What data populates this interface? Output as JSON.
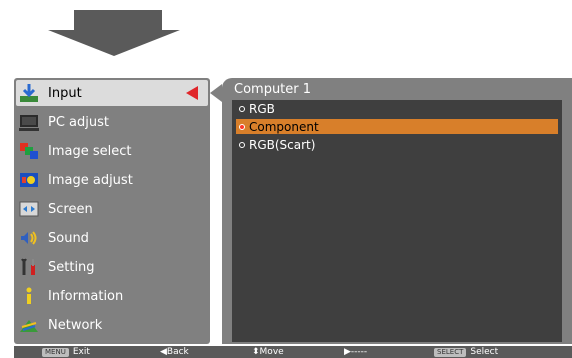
{
  "menu": {
    "items": [
      {
        "label": "Input",
        "icon": "input-icon"
      },
      {
        "label": "PC adjust",
        "icon": "pc-adjust-icon"
      },
      {
        "label": "Image select",
        "icon": "image-select-icon"
      },
      {
        "label": "Image adjust",
        "icon": "image-adjust-icon"
      },
      {
        "label": "Screen",
        "icon": "screen-icon"
      },
      {
        "label": "Sound",
        "icon": "sound-icon"
      },
      {
        "label": "Setting",
        "icon": "setting-icon"
      },
      {
        "label": "Information",
        "icon": "information-icon"
      },
      {
        "label": "Network",
        "icon": "network-icon"
      }
    ],
    "selected_index": 0
  },
  "submenu": {
    "title": "Computer 1",
    "options": [
      "RGB",
      "Component",
      "RGB(Scart)"
    ],
    "selected_index": 1
  },
  "statusbar": {
    "exit_key": "MENU",
    "exit_label": "Exit",
    "back_label": "Back",
    "move_label": "Move",
    "next_label": "-----",
    "select_key": "SELECT",
    "select_label": "Select"
  },
  "colors": {
    "panel": "#808080",
    "inner_panel": "#3f3f3f",
    "highlight": "#d87f2a",
    "pointer": "#e0262a"
  }
}
